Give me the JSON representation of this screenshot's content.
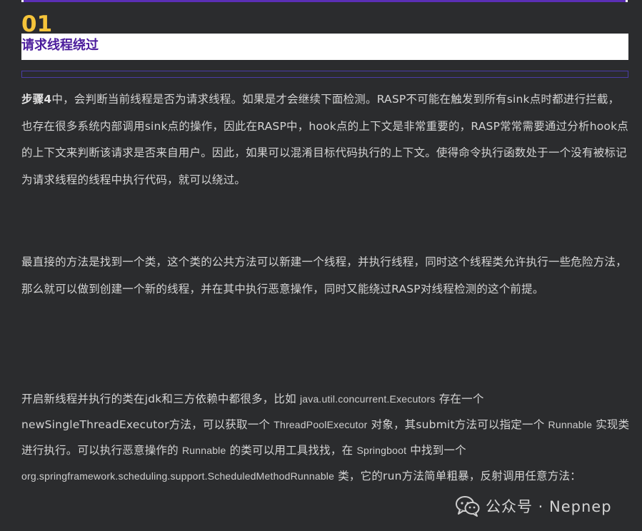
{
  "section": {
    "number": "01",
    "title": "请求线程绕过"
  },
  "paragraph1": {
    "lead": "步骤4",
    "text": "中，会判断当前线程是否为请求线程。如果是才会继续下面检测。RASP不可能在触发到所有sink点时都进行拦截，也存在很多系统内部调用sink点的操作，因此在RASP中，hook点的上下文是非常重要的，RASP常常需要通过分析hook点的上下文来判断该请求是否来自用户。因此，如果可以混淆目标代码执行的上下文。使得命令执行函数处于一个没有被标记为请求线程的线程中执行代码，就可以绕过。"
  },
  "paragraph2": {
    "text": "最直接的方法是找到一个类，这个类的公共方法可以新建一个线程，并执行线程，同时这个线程类允许执行一些危险方法， 那么就可以做到创建一个新的线程，并在其中执行恶意操作，同时又能绕过RASP对线程检测的这个前提。"
  },
  "paragraph3": {
    "t1": "开启新线程并执行的类在jdk和三方依赖中都很多，比如 ",
    "c1": "java.util.concurrent.Executors",
    "t2": " 存在一个newSingleThreadExecutor方法，可以获取一个 ",
    "c2": "ThreadPoolExecutor",
    "t3": " 对象，其submit方法可以指定一个 ",
    "c3": "Runnable",
    "t4": " 实现类进行执行。可以执行恶意操作的 ",
    "c4": "Runnable",
    "t5": " 的类可以用工具找找，在 ",
    "c5": "Springboot",
    "t6": " 中找到一个 ",
    "c6": "org.springframework.scheduling.support.ScheduledMethodRunnable",
    "t7": " 类，它的run方法简单粗暴，反射调用任意方法："
  },
  "watermark": {
    "icon": "wechat-icon",
    "text": "公众号 · Nepnep"
  },
  "colors": {
    "background": "#2b2c2e",
    "accent_purple": "#5b2fb5",
    "number_yellow": "#f5c43a",
    "title_purple": "#4b1c9c"
  }
}
